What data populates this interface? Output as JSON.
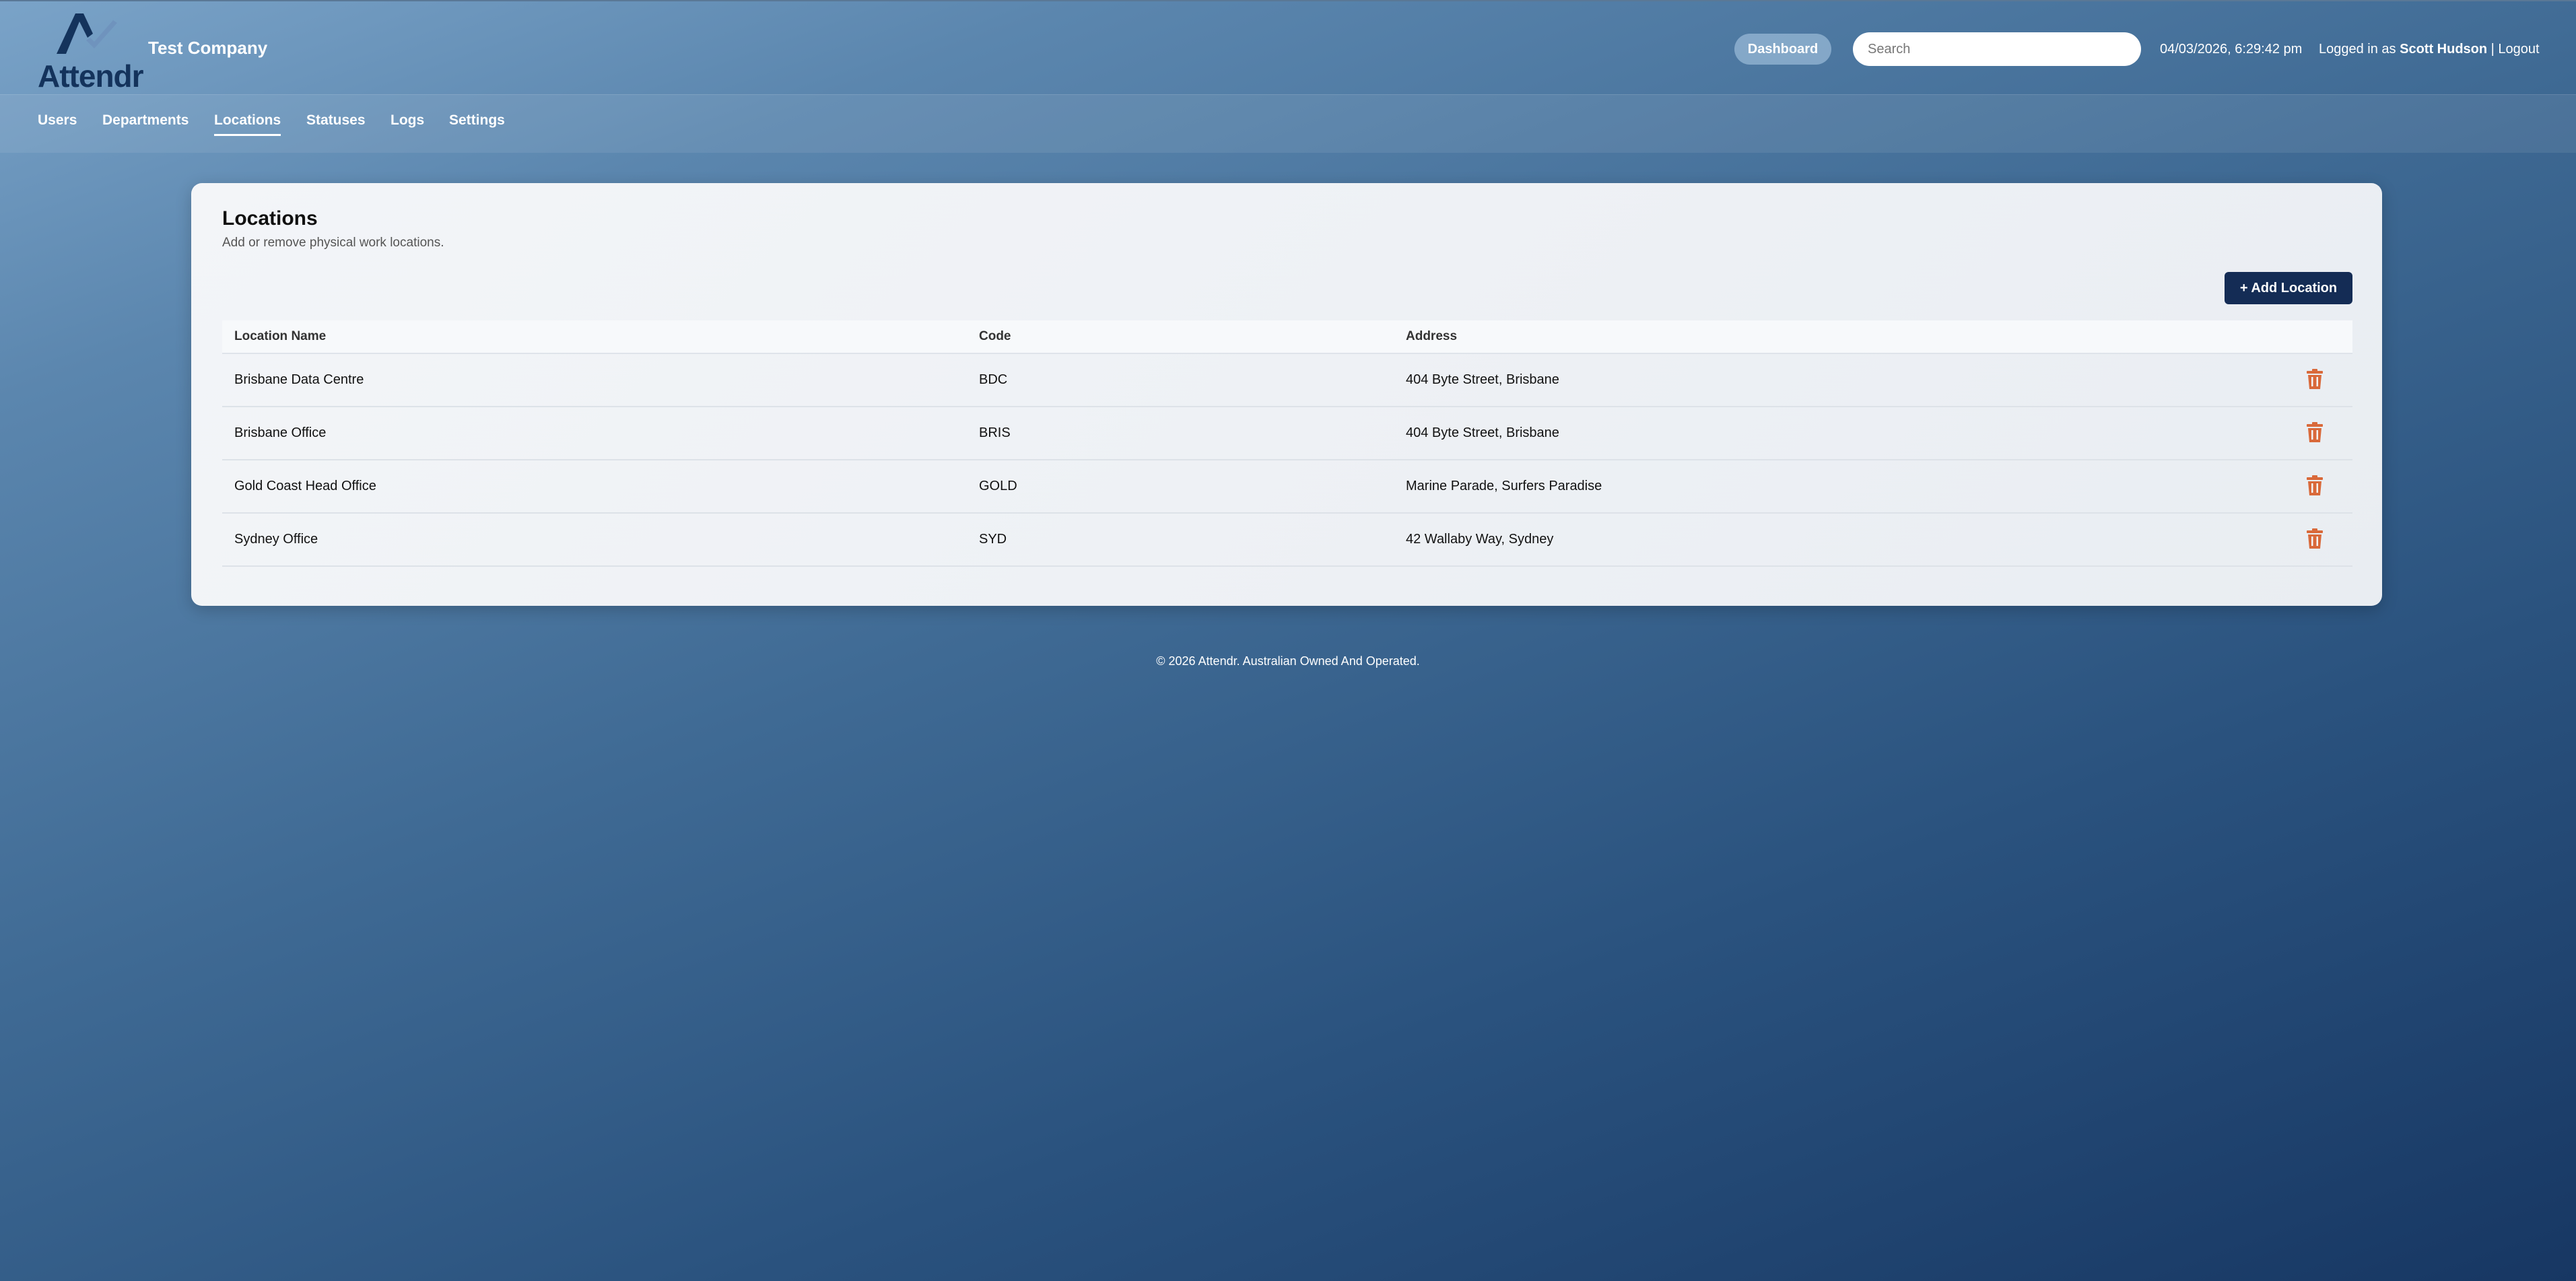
{
  "brand": {
    "logo_text": "Attendr",
    "company": "Test Company"
  },
  "header": {
    "dashboard_label": "Dashboard",
    "search_placeholder": "Search",
    "datetime": "04/03/2026, 6:29:42 pm",
    "logged_in_prefix": "Logged in as ",
    "user_name": "Scott Hudson",
    "separator": " | ",
    "logout_label": "Logout"
  },
  "nav": {
    "items": [
      {
        "label": "Users"
      },
      {
        "label": "Departments"
      },
      {
        "label": "Locations",
        "active": true
      },
      {
        "label": "Statuses"
      },
      {
        "label": "Logs"
      },
      {
        "label": "Settings"
      }
    ]
  },
  "main": {
    "title": "Locations",
    "subtitle": "Add or remove physical work locations.",
    "add_button": "+ Add Location",
    "columns": [
      "Location Name",
      "Code",
      "Address"
    ],
    "rows": [
      {
        "name": "Brisbane Data Centre",
        "code": "BDC",
        "address": "404 Byte Street, Brisbane"
      },
      {
        "name": "Brisbane Office",
        "code": "BRIS",
        "address": "404 Byte Street, Brisbane"
      },
      {
        "name": "Gold Coast Head Office",
        "code": "GOLD",
        "address": "Marine Parade, Surfers Paradise"
      },
      {
        "name": "Sydney Office",
        "code": "SYD",
        "address": "42 Wallaby Way, Sydney"
      }
    ],
    "delete_icon": "trash-icon"
  },
  "footer": {
    "text": "© 2026 Attendr. Australian Owned And Operated."
  },
  "colors": {
    "accent": "#142c55",
    "delete": "#d9693a"
  }
}
